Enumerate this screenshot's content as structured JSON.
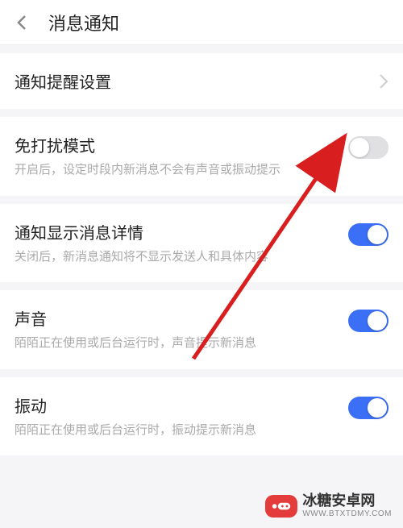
{
  "header": {
    "title": "消息通知"
  },
  "sections": {
    "notify_settings": {
      "title": "通知提醒设置"
    },
    "dnd": {
      "title": "免打扰模式",
      "desc": "开启后，设定时段内新消息不会有声音或振动提示",
      "enabled": false
    },
    "detail": {
      "title": "通知显示消息详情",
      "desc": "关闭后，新消息通知将不显示发送人和具体内容",
      "enabled": true
    },
    "sound": {
      "title": "声音",
      "desc": "陌陌正在使用或后台运行时，声音提示新消息",
      "enabled": true
    },
    "vibrate": {
      "title": "振动",
      "desc": "陌陌正在使用或后台运行时，振动提示新消息",
      "enabled": true
    }
  },
  "watermark": {
    "text": "冰糖安卓网",
    "sub": "WWW.BTXTDMY.COM"
  },
  "arrow_color": "#d81e1e"
}
